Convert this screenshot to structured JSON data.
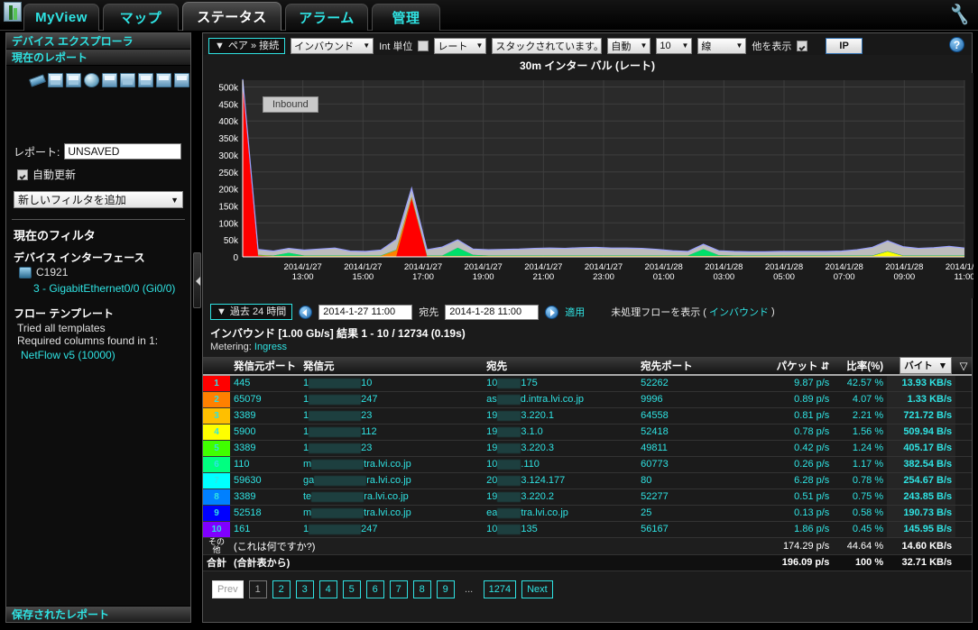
{
  "app": {
    "logo_icon": "app-logo-icon",
    "wrench_icon": "wrench-icon",
    "tabs": [
      {
        "label": "MyView",
        "active": false
      },
      {
        "label": "マップ",
        "active": false
      },
      {
        "label": "ステータス",
        "active": true
      },
      {
        "label": "アラーム",
        "active": false
      },
      {
        "label": "管理",
        "active": false
      }
    ]
  },
  "sidebar": {
    "header": "デバイス エクスプローラ",
    "current_report_header": "現在のレポート",
    "toolbar_icons": [
      "eraser-icon",
      "save-icon",
      "save-as-icon",
      "schedule-clock-icon",
      "print-icon",
      "share-icon",
      "report-icon",
      "email-icon",
      "pdf-icon"
    ],
    "report_label": "レポート:",
    "report_value": "UNSAVED",
    "report_placeholder": "UNSAVED",
    "autorefresh_label": "自動更新",
    "autorefresh_checked": true,
    "add_filter_label": "新しいフィルタを追加",
    "current_filter_header": "現在のフィルタ",
    "device_interface_title": "デバイス インターフェース",
    "device_name": "C1921",
    "device_icon": "router-icon",
    "interface_label": "3 - GigabitEthernet0/0 (Gi0/0)",
    "flow_template_title": "フロー テンプレート",
    "flow_template_line1": "Tried all templates",
    "flow_template_line2": "Required columns found in 1:",
    "flow_template_link": "NetFlow v5 (10000)",
    "saved_reports_header": "保存されたレポート",
    "splitter_icon": "collapse-left-icon"
  },
  "toolbar": {
    "pair_button": "ペア » 接続",
    "pair_caret": "▼",
    "direction_select": "インバウンド",
    "int_units_label": "Int 単位",
    "int_units_checked": false,
    "rate_select": "レート",
    "stack_select": "スタックされています。",
    "auto_select": "自動",
    "count_select": "10",
    "line_select": "線",
    "show_other_label": "他を表示",
    "show_other_checked": true,
    "ip_button": "IP",
    "help_icon": "help-icon"
  },
  "time_controls": {
    "range_button": "過去 24 時間",
    "range_caret": "▼",
    "prev_icon": "prev-arrow-icon",
    "next_icon": "next-arrow-icon",
    "start_value": "2014-1-27 11:00",
    "to_label": "宛先",
    "end_value": "2014-1-28 11:00",
    "apply_label": "適用",
    "raw_flows_label": "未処理フローを表示 (",
    "raw_flows_dir": "インバウンド",
    "raw_flows_close": ")"
  },
  "results": {
    "summary": "インバウンド [1.00 Gb/s] 結果 1 - 10 / 12734 (0.19s)",
    "metering_label": "Metering:",
    "metering_value": "Ingress"
  },
  "table": {
    "headers": {
      "rank": "",
      "src_port": "発信元ポート",
      "src": "発信元",
      "dst": "宛先",
      "dst_port": "宛先ポート",
      "packets": "パケット",
      "packets_sort_icon": "sort-updown-icon",
      "percent": "比率(%)",
      "bytes": "バイト",
      "bytes_caret": "▼",
      "menu_icon": "filter-caret-icon"
    },
    "rows": [
      {
        "rank": "1",
        "color": "#ff0000",
        "src_port": "445",
        "src_prefix": "1",
        "src_redact_w": 58,
        "src_suffix": "10",
        "dst_prefix": "10",
        "dst_redact_w": 26,
        "dst_suffix": "175",
        "dst_port": "52262",
        "packets": "9.87 p/s",
        "percent": "42.57 %",
        "bytes": "13.93 KB/s"
      },
      {
        "rank": "2",
        "color": "#ff8000",
        "src_port": "65079",
        "src_prefix": "1",
        "src_redact_w": 58,
        "src_suffix": "247",
        "dst_prefix": "as",
        "dst_redact_w": 26,
        "dst_suffix": "d.intra.lvi.co.jp",
        "dst_port": "9996",
        "packets": "0.89 p/s",
        "percent": "4.07 %",
        "bytes": "1.33 KB/s"
      },
      {
        "rank": "3",
        "color": "#ffbf00",
        "src_port": "3389",
        "src_prefix": "1",
        "src_redact_w": 58,
        "src_suffix": "23",
        "dst_prefix": "19",
        "dst_redact_w": 26,
        "dst_suffix": "3.220.1",
        "dst_port": "64558",
        "packets": "0.81 p/s",
        "percent": "2.21 %",
        "bytes": "721.72 B/s"
      },
      {
        "rank": "4",
        "color": "#ffff00",
        "src_port": "5900",
        "src_prefix": "1",
        "src_redact_w": 58,
        "src_suffix": "112",
        "dst_prefix": "19",
        "dst_redact_w": 26,
        "dst_suffix": "3.1.0",
        "dst_port": "52418",
        "packets": "0.78 p/s",
        "percent": "1.56 %",
        "bytes": "509.94 B/s"
      },
      {
        "rank": "5",
        "color": "#40ff00",
        "src_port": "3389",
        "src_prefix": "1",
        "src_redact_w": 58,
        "src_suffix": "23",
        "dst_prefix": "19",
        "dst_redact_w": 26,
        "dst_suffix": "3.220.3",
        "dst_port": "49811",
        "packets": "0.42 p/s",
        "percent": "1.24 %",
        "bytes": "405.17 B/s"
      },
      {
        "rank": "6",
        "color": "#00ff80",
        "src_port": "110",
        "src_prefix": "m",
        "src_redact_w": 58,
        "src_suffix": "tra.lvi.co.jp",
        "dst_prefix": "10",
        "dst_redact_w": 26,
        "dst_suffix": ".110",
        "dst_port": "60773",
        "packets": "0.26 p/s",
        "percent": "1.17 %",
        "bytes": "382.54 B/s"
      },
      {
        "rank": "7",
        "color": "#00ffff",
        "src_port": "59630",
        "src_prefix": "ga",
        "src_redact_w": 58,
        "src_suffix": "ra.lvi.co.jp",
        "dst_prefix": "20",
        "dst_redact_w": 26,
        "dst_suffix": "3.124.177",
        "dst_port": "80",
        "packets": "6.28 p/s",
        "percent": "0.78 %",
        "bytes": "254.67 B/s"
      },
      {
        "rank": "8",
        "color": "#0080ff",
        "src_port": "3389",
        "src_prefix": "te",
        "src_redact_w": 58,
        "src_suffix": "ra.lvi.co.jp",
        "dst_prefix": "19",
        "dst_redact_w": 26,
        "dst_suffix": "3.220.2",
        "dst_port": "52277",
        "packets": "0.51 p/s",
        "percent": "0.75 %",
        "bytes": "243.85 B/s"
      },
      {
        "rank": "9",
        "color": "#0000ff",
        "src_port": "52518",
        "src_prefix": "m",
        "src_redact_w": 58,
        "src_suffix": "tra.lvi.co.jp",
        "dst_prefix": "ea",
        "dst_redact_w": 26,
        "dst_suffix": "tra.lvi.co.jp",
        "dst_port": "25",
        "packets": "0.13 p/s",
        "percent": "0.58 %",
        "bytes": "190.73 B/s"
      },
      {
        "rank": "10",
        "color": "#8000ff",
        "src_port": "161",
        "src_prefix": "1",
        "src_redact_w": 58,
        "src_suffix": "247",
        "dst_prefix": "10",
        "dst_redact_w": 26,
        "dst_suffix": "135",
        "dst_port": "56167",
        "packets": "1.86 p/s",
        "percent": "0.45 %",
        "bytes": "145.95 B/s"
      }
    ],
    "other_row": {
      "label": "その他",
      "text": "(これは何ですか?)",
      "packets": "174.29 p/s",
      "percent": "44.64 %",
      "bytes": "14.60 KB/s"
    },
    "total_row": {
      "label": "合計",
      "text": "(合計表から)",
      "packets": "196.09 p/s",
      "percent": "100 %",
      "bytes": "32.71 KB/s"
    }
  },
  "pagination": {
    "prev": "Prev",
    "pages": [
      "1",
      "2",
      "3",
      "4",
      "5",
      "6",
      "7",
      "8",
      "9"
    ],
    "ellipsis": "...",
    "last": "1274",
    "next": "Next",
    "current": "1"
  },
  "chart_data": {
    "type": "area",
    "title": "30m インター バル (レート)",
    "xlabel": "",
    "ylabel": "",
    "ylim": [
      0,
      520000
    ],
    "grid": true,
    "legend": "Inbound",
    "ytick_labels": [
      "0",
      "50k",
      "100k",
      "150k",
      "200k",
      "250k",
      "300k",
      "350k",
      "400k",
      "450k",
      "500k"
    ],
    "ytick_values": [
      0,
      50000,
      100000,
      150000,
      200000,
      250000,
      300000,
      350000,
      400000,
      450000,
      500000
    ],
    "xtick_labels": [
      "2014/1/27\n13:00",
      "2014/1/27\n15:00",
      "2014/1/27\n17:00",
      "2014/1/27\n19:00",
      "2014/1/27\n21:00",
      "2014/1/27\n23:00",
      "2014/1/28\n01:00",
      "2014/1/28\n03:00",
      "2014/1/28\n05:00",
      "2014/1/28\n07:00",
      "2014/1/28\n09:00",
      "2014/1/28\n11:00"
    ],
    "x": [
      0,
      1,
      2,
      3,
      4,
      5,
      6,
      7,
      8,
      9,
      10,
      11,
      12,
      13,
      14,
      15,
      16,
      17,
      18,
      19,
      20,
      21,
      22,
      23,
      24,
      25,
      26,
      27,
      28,
      29,
      30,
      31,
      32,
      33,
      34,
      35,
      36,
      37,
      38,
      39,
      40,
      41,
      42,
      43,
      44,
      45,
      46,
      47
    ],
    "series": [
      {
        "name": "rank1-red",
        "color": "#ff0000",
        "values": [
          510000,
          3000,
          1000,
          1000,
          1000,
          1000,
          1000,
          1000,
          1000,
          1000,
          1000,
          170000,
          1000,
          1000,
          1000,
          1000,
          1000,
          1000,
          1000,
          1000,
          1000,
          1000,
          1000,
          1000,
          1000,
          1000,
          1000,
          1000,
          1000,
          1000,
          1000,
          1000,
          1000,
          1000,
          1000,
          1000,
          1000,
          1000,
          1000,
          1000,
          1000,
          1000,
          1000,
          1000,
          1000,
          1000,
          1000,
          1000
        ]
      },
      {
        "name": "rank2-orange",
        "color": "#ff8000",
        "values": [
          2000,
          1000,
          1000,
          1000,
          1000,
          1000,
          1000,
          1000,
          1000,
          1000,
          18000,
          5000,
          1000,
          1000,
          1000,
          1000,
          1000,
          1000,
          1000,
          1000,
          1000,
          1000,
          1000,
          1000,
          1000,
          1000,
          1000,
          1000,
          1000,
          1000,
          1000,
          1000,
          1000,
          1000,
          1000,
          1000,
          1000,
          1000,
          1000,
          1000,
          1000,
          1000,
          1000,
          1000,
          1000,
          1000,
          1000,
          1000
        ]
      },
      {
        "name": "rank4-yellow",
        "color": "#ffff00",
        "values": [
          1000,
          1000,
          1000,
          1000,
          1000,
          1000,
          1000,
          1000,
          1000,
          1000,
          1000,
          1000,
          1000,
          1000,
          1000,
          1000,
          1000,
          1000,
          1000,
          1000,
          1000,
          1000,
          1000,
          1000,
          1000,
          1000,
          1000,
          1000,
          1000,
          1000,
          1000,
          1000,
          1000,
          1000,
          1000,
          1000,
          1000,
          1000,
          1000,
          1000,
          1000,
          1000,
          14000,
          1000,
          1000,
          1000,
          1000,
          1000
        ]
      },
      {
        "name": "rank6-green",
        "color": "#00e06a",
        "values": [
          1000,
          1000,
          1000,
          9000,
          1000,
          1000,
          1000,
          1000,
          1000,
          1000,
          1000,
          1000,
          1000,
          1000,
          24000,
          3000,
          1000,
          1000,
          1000,
          1000,
          1000,
          1000,
          1000,
          1000,
          1000,
          1000,
          1000,
          1000,
          1000,
          1000,
          20000,
          2000,
          1000,
          1000,
          1000,
          1000,
          1000,
          1000,
          1000,
          1000,
          1000,
          1000,
          1000,
          1000,
          1000,
          1000,
          1000,
          1000
        ]
      },
      {
        "name": "other-gray",
        "color": "#bdbdbd",
        "values": [
          9000,
          16000,
          13000,
          13000,
          16000,
          19000,
          22000,
          13000,
          12000,
          16000,
          30000,
          25000,
          17000,
          25000,
          23000,
          17000,
          17000,
          18000,
          19000,
          21000,
          22000,
          21000,
          23000,
          24000,
          22000,
          22000,
          21000,
          18000,
          14000,
          12000,
          14000,
          13000,
          12000,
          11000,
          11000,
          12000,
          12000,
          12000,
          12000,
          13000,
          17000,
          24000,
          30000,
          26000,
          21000,
          23000,
          27000,
          22000
        ]
      }
    ]
  }
}
